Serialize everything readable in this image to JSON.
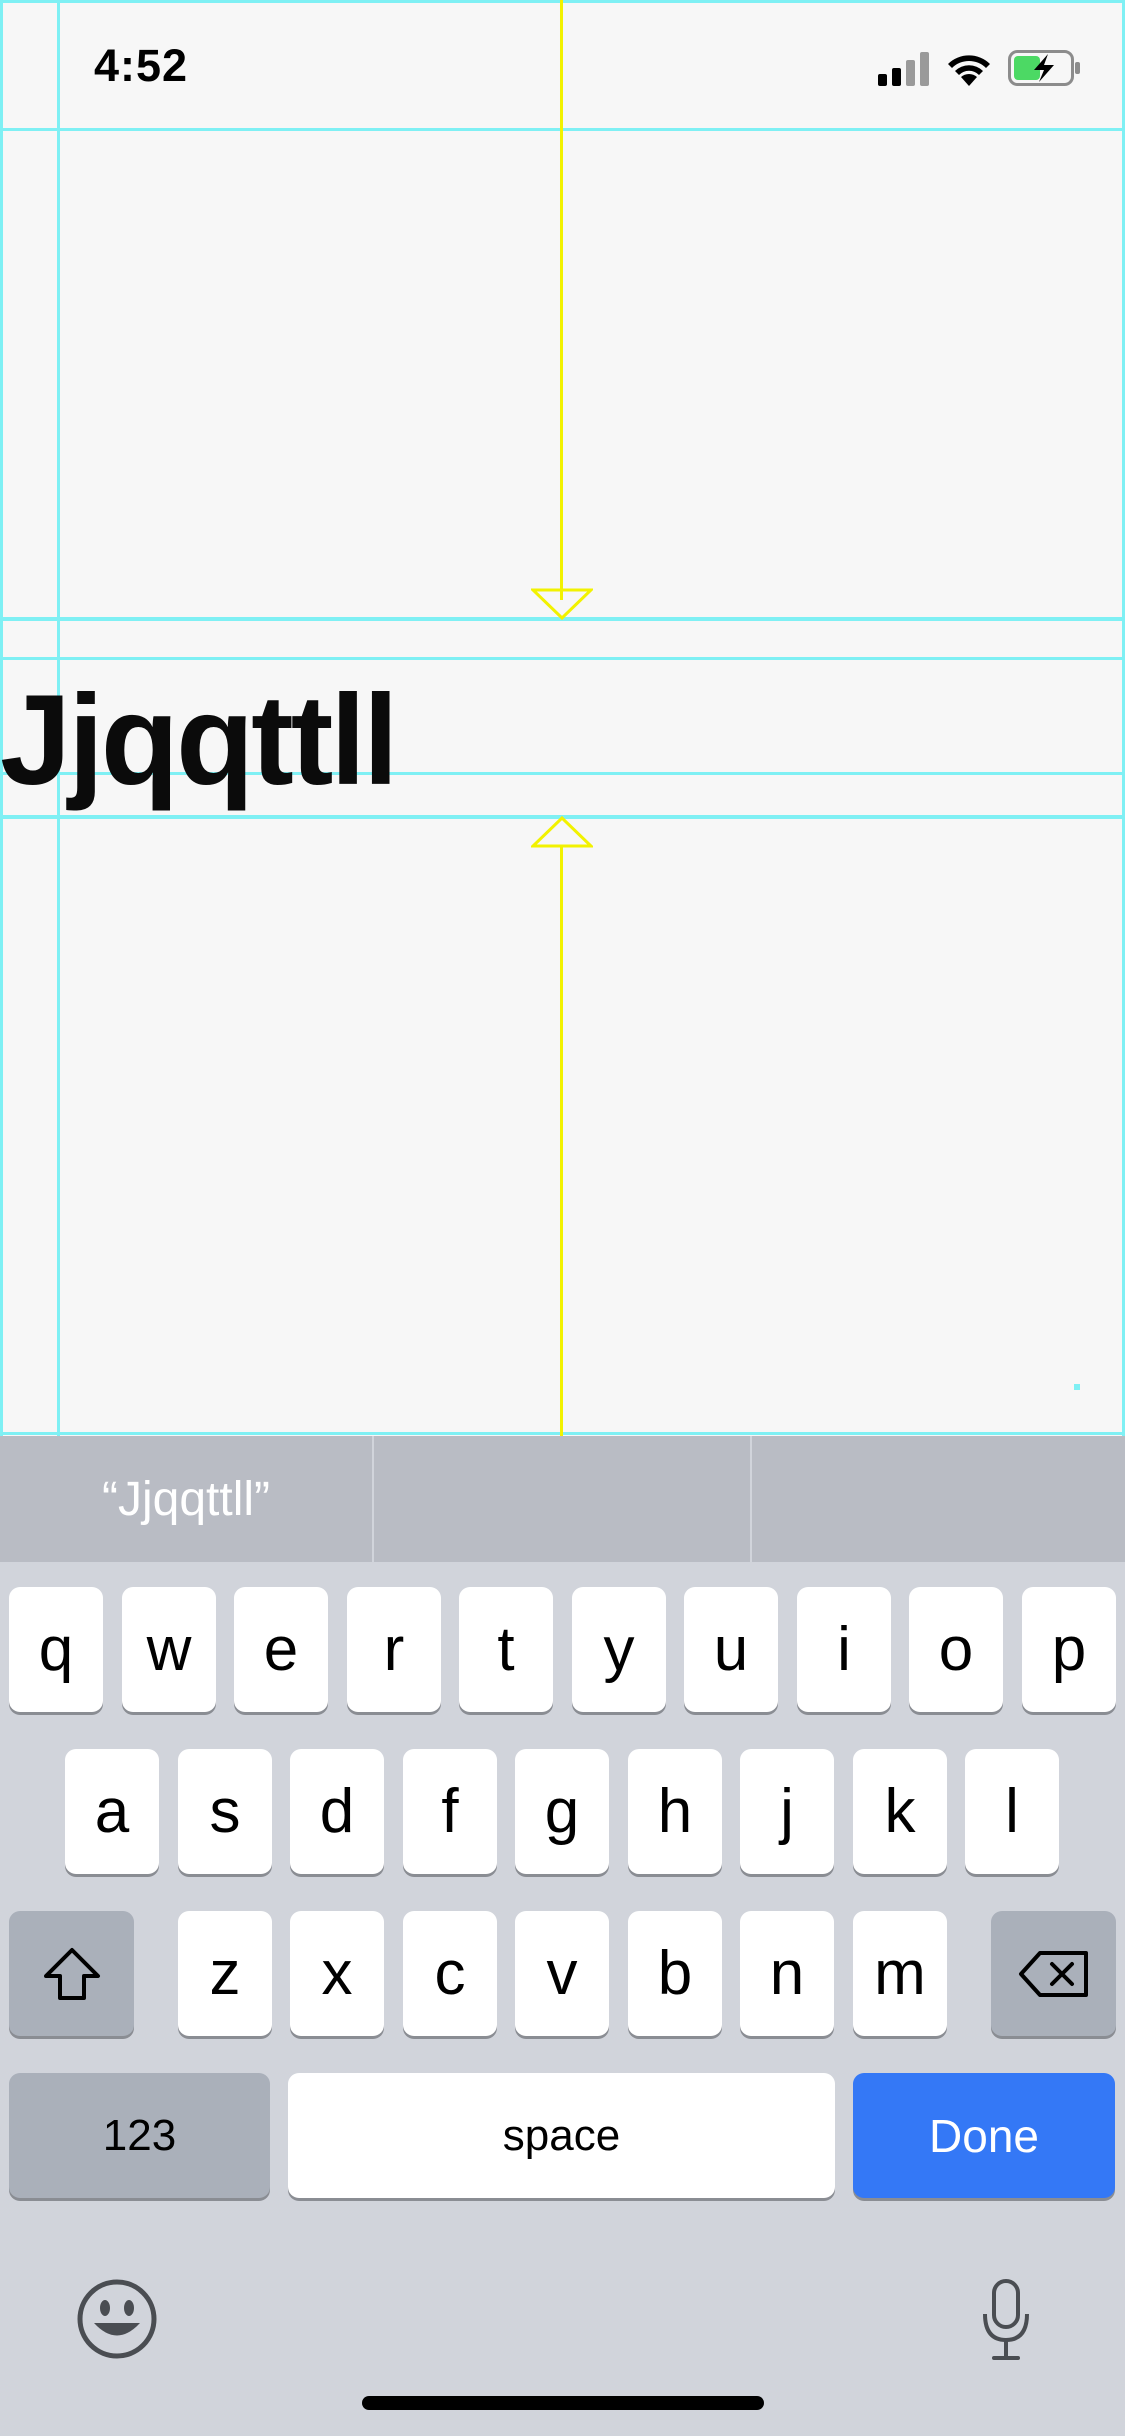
{
  "status_bar": {
    "time": "4:52"
  },
  "canvas": {
    "text": "Jjqqttll"
  },
  "predictions": {
    "items": [
      "“Jjqqttll”",
      "",
      ""
    ]
  },
  "keyboard": {
    "row1": [
      "q",
      "w",
      "e",
      "r",
      "t",
      "y",
      "u",
      "i",
      "o",
      "p"
    ],
    "row2": [
      "a",
      "s",
      "d",
      "f",
      "g",
      "h",
      "j",
      "k",
      "l"
    ],
    "row3": [
      "z",
      "x",
      "c",
      "v",
      "b",
      "n",
      "m"
    ],
    "numbers_label": "123",
    "space_label": "space",
    "done_label": "Done"
  },
  "colors": {
    "guide": "#7ff0f4",
    "baseline_guide": "#f2f200",
    "done_key": "#3478f6",
    "keyboard_bg": "#d1d4db"
  },
  "icons": [
    "signal-icon",
    "wifi-icon",
    "battery-charging-icon",
    "shift-icon",
    "delete-icon",
    "emoji-icon",
    "microphone-icon"
  ]
}
